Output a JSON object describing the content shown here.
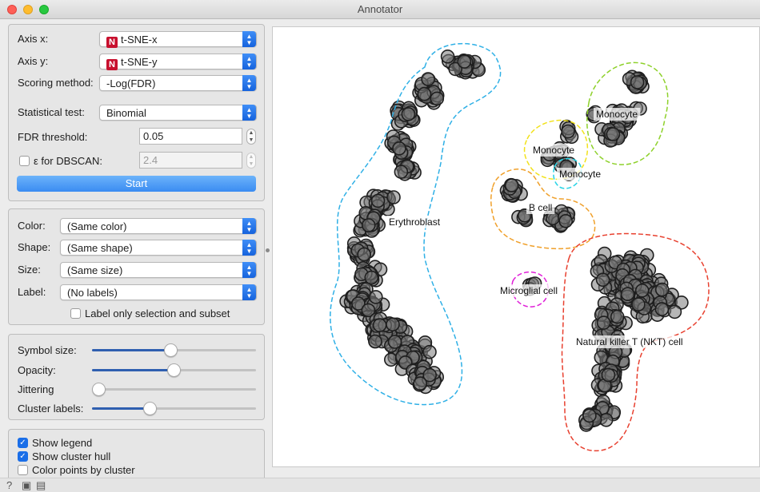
{
  "window": {
    "title": "Annotator"
  },
  "annotation": {
    "axis_x_label": "Axis x:",
    "axis_x_badge": "N",
    "axis_x_value": "t-SNE-x",
    "axis_y_label": "Axis y:",
    "axis_y_badge": "N",
    "axis_y_value": "t-SNE-y",
    "scoring_label": "Scoring method:",
    "scoring_value": "-Log(FDR)",
    "test_label": "Statistical test:",
    "test_value": "Binomial",
    "fdr_label": "FDR threshold:",
    "fdr_value": "0.05",
    "eps_label": "ε for DBSCAN:",
    "eps_value": "2.4",
    "eps_checked": false,
    "start_label": "Start"
  },
  "attributes": {
    "color_label": "Color:",
    "color_value": "(Same color)",
    "shape_label": "Shape:",
    "shape_value": "(Same shape)",
    "size_label": "Size:",
    "size_value": "(Same size)",
    "label_label": "Label:",
    "label_value": "(No labels)",
    "label_only_selection": "Label only selection and subset",
    "label_only_selection_checked": false
  },
  "sliders": {
    "symbol_size_label": "Symbol size:",
    "symbol_size": 0.48,
    "opacity_label": "Opacity:",
    "opacity": 0.5,
    "jittering_label": "Jittering",
    "jittering": 0.0,
    "cluster_labels_label": "Cluster labels:",
    "cluster_labels": 0.34
  },
  "options": {
    "show_legend": "Show legend",
    "show_legend_checked": true,
    "show_cluster_hull": "Show cluster hull",
    "show_cluster_hull_checked": true,
    "color_points": "Color points by cluster",
    "color_points_checked": false
  },
  "plot": {
    "clusters": [
      {
        "label": "Erythroblast",
        "color": "#2fb0e6"
      },
      {
        "label": "Monocyte",
        "color": "#8ed12b"
      },
      {
        "label": "Monocyte",
        "color": "#f2e21a"
      },
      {
        "label": "Monocyte",
        "color": "#25d3e6"
      },
      {
        "label": "B cell",
        "color": "#f0a02a"
      },
      {
        "label": "Microglial cell",
        "color": "#e01fd8"
      },
      {
        "label": "Natural killer T (NKT) cell",
        "color": "#e8402f"
      }
    ]
  },
  "status": {
    "help_icon": "help-icon",
    "save_icon": "save-icon",
    "report_icon": "report-icon"
  }
}
